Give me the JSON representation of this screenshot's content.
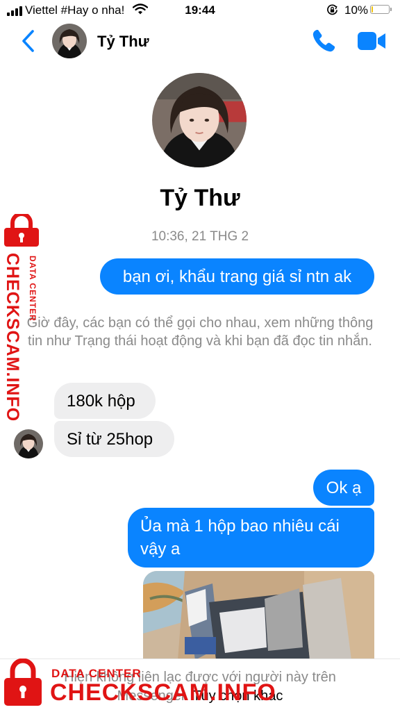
{
  "status_bar": {
    "carrier": "Viettel #Hay o nha!",
    "time": "19:44",
    "battery_percent": "10%",
    "battery_level": 0.1,
    "battery_color": "#f1c40f",
    "icons": [
      "signal-icon",
      "wifi-icon",
      "orientation-lock-icon",
      "battery-icon"
    ]
  },
  "header": {
    "contact_name": "Tỷ Thư",
    "accent_color": "#0a84ff",
    "icons": [
      "back-chevron-icon",
      "phone-icon",
      "video-camera-icon"
    ]
  },
  "profile": {
    "name": "Tỷ Thư"
  },
  "conversation": {
    "timestamp": "10:36, 21 THG 2",
    "notice": "Giờ đây, các bạn có thể gọi cho nhau, xem những thông tin như Trạng thái hoạt động và khi bạn đã đọc tin nhắn.",
    "messages": [
      {
        "direction": "outgoing",
        "text": "bạn ơi, khẩu trang giá sỉ ntn ak"
      },
      {
        "direction": "incoming",
        "text": "180k hộp"
      },
      {
        "direction": "incoming",
        "text": "Sỉ từ 25hop"
      },
      {
        "direction": "outgoing",
        "text": "Ok ạ"
      },
      {
        "direction": "outgoing",
        "text": "Ủa mà 1 hộp bao nhiêu cái vậy a"
      },
      {
        "direction": "outgoing",
        "type": "photo"
      }
    ]
  },
  "footer": {
    "text": "Hiện không liên lạc được với người này trên Messenger.",
    "link": "Tùy chọn khác"
  },
  "watermark": {
    "side_main": "CHECKSCAM.INFO",
    "side_sub": "DATA CENTER",
    "bottom_sub": "DATA CENTER",
    "bottom_main": "CHECKSCAM.INFO",
    "color": "#e01414"
  }
}
